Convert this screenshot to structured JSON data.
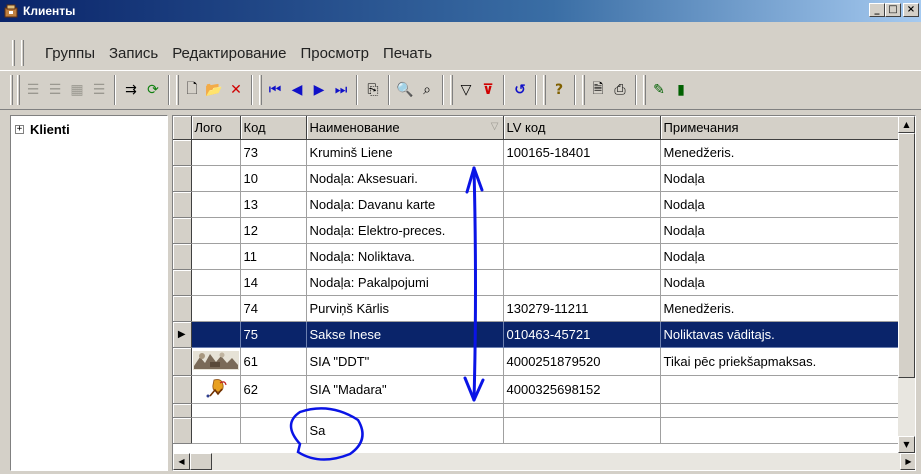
{
  "window": {
    "title": "Клиенты",
    "buttons": {
      "minimize": "_",
      "maximize": "□",
      "close": "×"
    }
  },
  "menu": {
    "items": [
      "Группы",
      "Запись",
      "Редактирование",
      "Просмотр",
      "Печать"
    ]
  },
  "toolbar": {
    "buttons": [
      {
        "name": "list-icon-1",
        "glyph": "☰",
        "enabled": false
      },
      {
        "name": "list-icon-2",
        "glyph": "☰",
        "enabled": false
      },
      {
        "name": "properties-icon",
        "glyph": "▦",
        "enabled": false
      },
      {
        "name": "list-icon-3",
        "glyph": "☰",
        "enabled": false
      },
      {
        "name": "export-icon",
        "glyph": "⇉",
        "enabled": true
      },
      {
        "name": "refresh-icon",
        "glyph": "⟳",
        "enabled": true
      },
      {
        "name": "new-record-icon",
        "glyph": "🗋",
        "enabled": true
      },
      {
        "name": "open-icon",
        "glyph": "📂",
        "enabled": true
      },
      {
        "name": "delete-icon",
        "glyph": "✕",
        "enabled": true
      },
      {
        "name": "first-record-icon",
        "glyph": "⏮",
        "enabled": true
      },
      {
        "name": "prev-record-icon",
        "glyph": "◀",
        "enabled": true
      },
      {
        "name": "next-record-icon",
        "glyph": "▶",
        "enabled": true
      },
      {
        "name": "last-record-icon",
        "glyph": "⏭",
        "enabled": true
      },
      {
        "name": "copy-icon",
        "glyph": "⎘",
        "enabled": true
      },
      {
        "name": "find-icon",
        "glyph": "🔍",
        "enabled": true
      },
      {
        "name": "find-next-icon",
        "glyph": "⌕",
        "enabled": true
      },
      {
        "name": "filter-icon",
        "glyph": "▽",
        "enabled": true
      },
      {
        "name": "clear-filter-icon",
        "glyph": "⊽",
        "enabled": true
      },
      {
        "name": "undo-icon",
        "glyph": "↺",
        "enabled": true
      },
      {
        "name": "help-icon",
        "glyph": "?",
        "enabled": true
      },
      {
        "name": "preview-icon",
        "glyph": "🗎",
        "enabled": true
      },
      {
        "name": "print-icon",
        "glyph": "⎙",
        "enabled": true
      },
      {
        "name": "edit-chart-icon",
        "glyph": "✎",
        "enabled": true
      },
      {
        "name": "chart-icon",
        "glyph": "▮",
        "enabled": true
      }
    ]
  },
  "tree": {
    "root": {
      "expander": "+",
      "label": "Klienti"
    }
  },
  "grid": {
    "columns": [
      "Лого",
      "Код",
      "Наименование",
      "LV код",
      "Примечания"
    ],
    "sort_indicator": "▽",
    "rows": [
      {
        "logo": "",
        "code": "73",
        "name": "Kruminš Liene",
        "lv": "100165-18401",
        "note": "Menedžeris.",
        "selected": false
      },
      {
        "logo": "",
        "code": "10",
        "name": "Nodaļa: Aksesuari.",
        "lv": "",
        "note": "Nodaļa",
        "selected": false
      },
      {
        "logo": "",
        "code": "13",
        "name": "Nodaļa: Davanu karte",
        "lv": "",
        "note": "Nodaļa",
        "selected": false
      },
      {
        "logo": "",
        "code": "12",
        "name": "Nodaļa: Elektro-preces.",
        "lv": "",
        "note": "Nodaļa",
        "selected": false
      },
      {
        "logo": "",
        "code": "11",
        "name": "Nodaļa: Noliktava.",
        "lv": "",
        "note": "Nodaļa",
        "selected": false
      },
      {
        "logo": "",
        "code": "14",
        "name": "Nodaļa: Pakalpojumi",
        "lv": "",
        "note": "Nodaļa",
        "selected": false
      },
      {
        "logo": "",
        "code": "74",
        "name": "Purviņš Kārlis",
        "lv": "130279-11211",
        "note": "Menedžeris.",
        "selected": false
      },
      {
        "logo": "",
        "code": "75",
        "name": "Sakse Inese",
        "lv": "010463-45721",
        "note": "Noliktavas vāditajs.",
        "selected": true
      },
      {
        "logo": "picture",
        "code": "61",
        "name": "SIA \"DDT\"",
        "lv": "4000251879520",
        "note": "Tikai pēc priekšapmaksas.",
        "selected": false
      },
      {
        "logo": "figure",
        "code": "62",
        "name": "SIA \"Madara\"",
        "lv": "4000325698152",
        "note": "",
        "selected": false
      },
      {
        "logo": "",
        "code": "",
        "name": "",
        "lv": "",
        "note": "",
        "selected": false
      },
      {
        "logo": "",
        "code": "",
        "name": "Sa",
        "lv": "",
        "note": "",
        "selected": false
      }
    ]
  },
  "colors": {
    "selection": "#0a246a",
    "annotation": "#0a14e6",
    "face": "#d4d0c8"
  }
}
